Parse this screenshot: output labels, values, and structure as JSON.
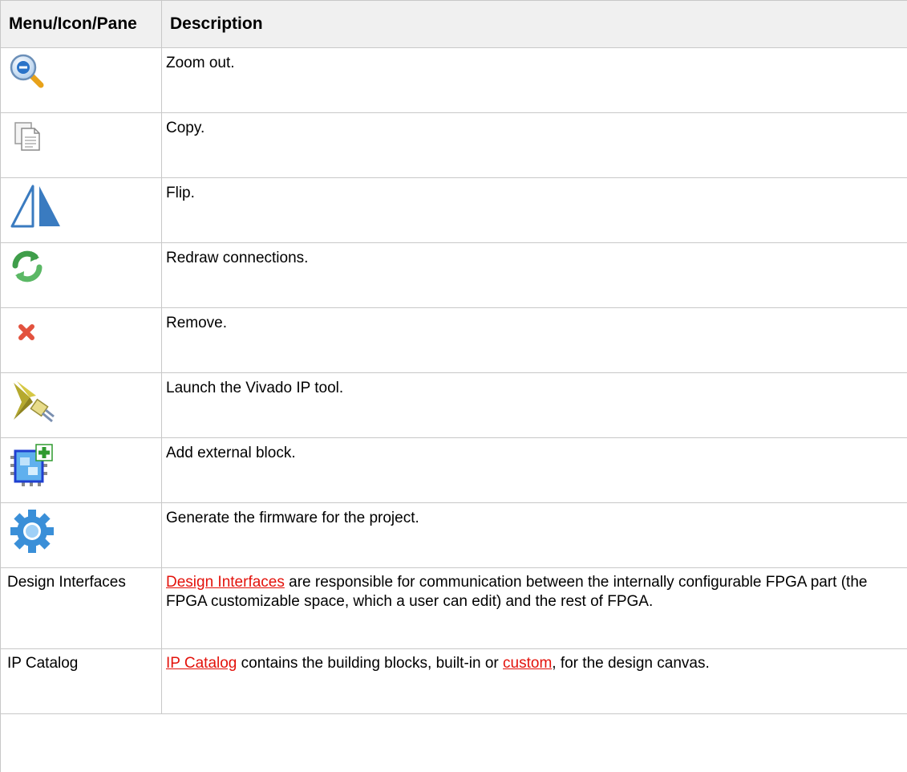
{
  "table": {
    "headers": [
      "Menu/Icon/Pane",
      "Description"
    ],
    "icon_rows": [
      {
        "icon": "zoom-out-icon",
        "description": "Zoom out."
      },
      {
        "icon": "copy-icon",
        "description": "Copy."
      },
      {
        "icon": "flip-icon",
        "description": "Flip."
      },
      {
        "icon": "redraw-connections-icon",
        "description": "Redraw connections."
      },
      {
        "icon": "remove-icon",
        "description": "Remove."
      },
      {
        "icon": "vivado-ip-tool-icon",
        "description": "Launch the Vivado IP tool."
      },
      {
        "icon": "add-external-block-icon",
        "description": "Add external block."
      },
      {
        "icon": "generate-firmware-icon",
        "description": "Generate the firmware for the project."
      }
    ],
    "text_rows": [
      {
        "name": "Design Interfaces",
        "link": "Design Interfaces",
        "rest": " are responsible for communication between the internally configurable FPGA part (the FPGA customizable space, which a user can edit) and the rest of FPGA."
      },
      {
        "name": "IP Catalog",
        "link": "IP Catalog",
        "mid": " contains the building blocks, built-in or ",
        "link2": "custom",
        "rest": ", for the design canvas."
      }
    ]
  },
  "colors": {
    "link": "#e3120b",
    "header_bg": "#f0f0f0",
    "border": "#c8c8c8"
  }
}
